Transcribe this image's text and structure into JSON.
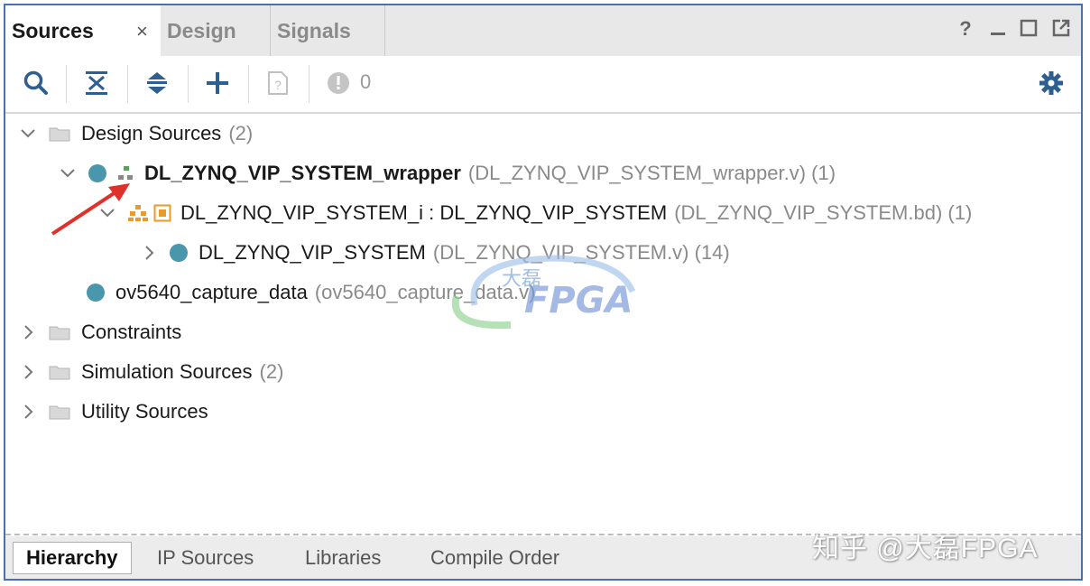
{
  "tabs": {
    "sources": "Sources",
    "close": "×",
    "design": "Design",
    "signals": "Signals"
  },
  "window_controls": {
    "help": "?",
    "minimize": "_"
  },
  "toolbar": {
    "problem_count": "0",
    "icons": [
      "search-icon",
      "collapse-all-icon",
      "expand-all-icon",
      "add-icon",
      "doc-help-icon",
      "warning-circle-icon",
      "gear-icon"
    ]
  },
  "tree": {
    "design_sources": {
      "label": "Design Sources",
      "count": "(2)"
    },
    "wrapper": {
      "label": "DL_ZYNQ_VIP_SYSTEM_wrapper",
      "file": "(DL_ZYNQ_VIP_SYSTEM_wrapper.v) (1)"
    },
    "bd_instance": {
      "label": "DL_ZYNQ_VIP_SYSTEM_i : DL_ZYNQ_VIP_SYSTEM",
      "file": "(DL_ZYNQ_VIP_SYSTEM.bd) (1)"
    },
    "system": {
      "label": "DL_ZYNQ_VIP_SYSTEM",
      "file": "(DL_ZYNQ_VIP_SYSTEM.v) (14)"
    },
    "capture": {
      "label": "ov5640_capture_data",
      "file": "(ov5640_capture_data.v)"
    },
    "constraints": {
      "label": "Constraints"
    },
    "simulation": {
      "label": "Simulation Sources",
      "count": "(2)"
    },
    "utility": {
      "label": "Utility Sources"
    }
  },
  "bottom_tabs": {
    "hierarchy": "Hierarchy",
    "ip_sources": "IP Sources",
    "libraries": "Libraries",
    "compile_order": "Compile Order"
  },
  "watermark": {
    "center_text": "FPGA",
    "center_chinese": "大磊",
    "bottom_right": "知乎 @大磊FPGA"
  },
  "colors": {
    "frame": "#4b6fb4",
    "accent_icon": "#2f5f8f",
    "dot": "#4a97ad",
    "arrow": "#e0302a"
  }
}
